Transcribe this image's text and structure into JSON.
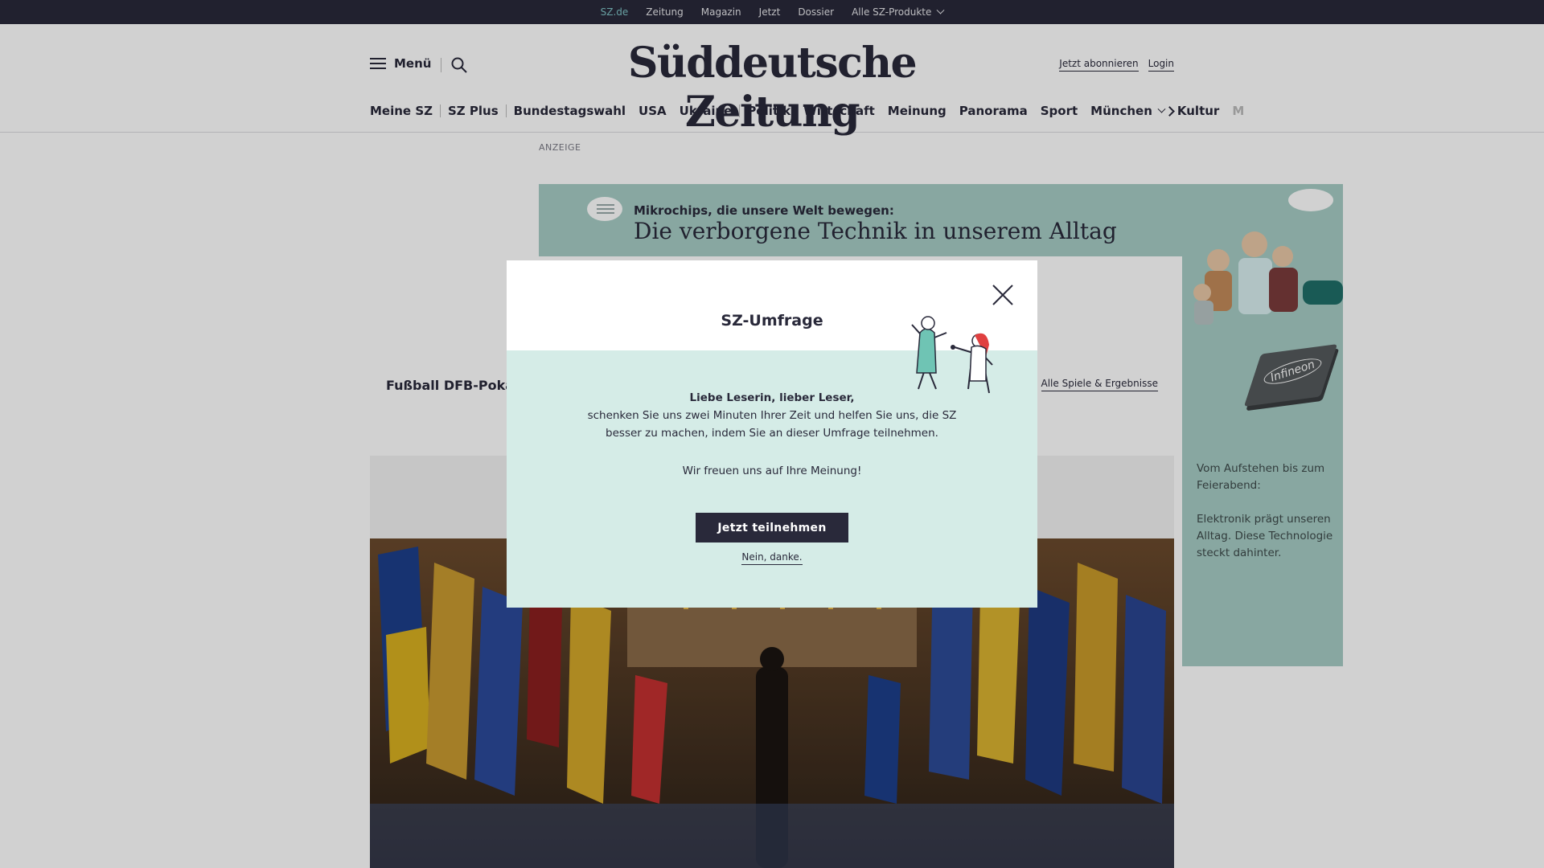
{
  "topbar": {
    "links": [
      "SZ.de",
      "Zeitung",
      "Magazin",
      "Jetzt",
      "Dossier",
      "Alle SZ-Produkte"
    ]
  },
  "header": {
    "menu_label": "Menü",
    "logo": "Süddeutsche Zeitung",
    "subscribe": "Jetzt abonnieren",
    "login": "Login"
  },
  "nav": {
    "items": [
      "Meine SZ",
      "SZ Plus",
      "Bundestagswahl",
      "USA",
      "Ukraine",
      "Politik",
      "Wirtschaft",
      "Meinung",
      "Panorama",
      "Sport",
      "München",
      "Kultur",
      "M"
    ]
  },
  "ad": {
    "label": "ANZEIGE",
    "banner_sub": "Mikrochips, die unsere Welt bewegen:",
    "banner_head": "Die verborgene Technik in unserem Alltag",
    "sky_text_1": "Vom Aufstehen bis zum Feierabend:",
    "sky_text_2": "Elektronik prägt unseren Alltag. Diese Technologie steckt dahinter.",
    "chip_logo": "Infineon"
  },
  "card": {
    "title": "Fußball DFB-Pokal",
    "link": "Alle Spiele & Ergebnisse"
  },
  "modal": {
    "title": "SZ-Umfrage",
    "greeting": "Liebe Leserin, lieber Leser,",
    "line1": "schenken Sie uns zwei Minuten Ihrer Zeit und helfen Sie uns, die SZ",
    "line2": "besser zu machen, indem Sie an dieser Umfrage teilnehmen.",
    "thanks": "Wir freuen uns auf Ihre Meinung!",
    "cta": "Jetzt teilnehmen",
    "decline": "Nein, danke."
  },
  "colors": {
    "dark": "#29293a",
    "accent": "#7fc4c6",
    "modal_bg": "#d5ece7",
    "ad_bg": "#a6ccc5"
  }
}
